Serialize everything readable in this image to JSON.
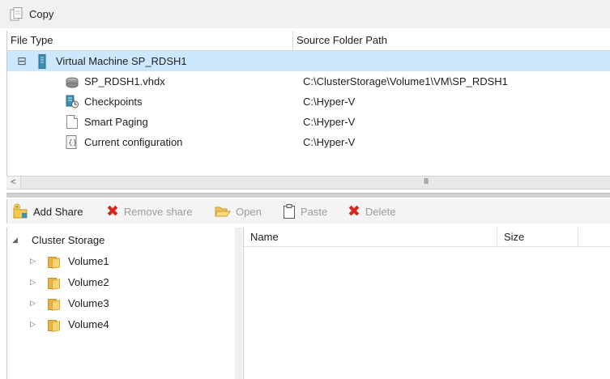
{
  "toolbar": {
    "copy_label": "Copy"
  },
  "grid": {
    "columns": [
      "File Type",
      "Source Folder Path"
    ],
    "vm_row": {
      "expander": "⊟",
      "label": "Virtual Machine SP_RDSH1"
    },
    "files": [
      {
        "name": "SP_RDSH1.vhdx",
        "path": "C:\\ClusterStorage\\Volume1\\VM\\SP_RDSH1",
        "icon": "disk-icon"
      },
      {
        "name": "Checkpoints",
        "path": "C:\\Hyper-V",
        "icon": "checkpoints-icon"
      },
      {
        "name": "Smart Paging",
        "path": "C:\\Hyper-V",
        "icon": "document-icon"
      },
      {
        "name": "Current configuration",
        "path": "C:\\Hyper-V",
        "icon": "configuration-icon"
      }
    ],
    "scroll_left": "<",
    "scroll_grip": "III"
  },
  "share_toolbar": {
    "add_share": "Add Share",
    "remove_share": "Remove share",
    "open": "Open",
    "paste": "Paste",
    "delete": "Delete"
  },
  "tree": {
    "root": {
      "expander": "◢",
      "label": "Cluster Storage"
    },
    "children": [
      {
        "expander": "▷",
        "label": "Volume1"
      },
      {
        "expander": "▷",
        "label": "Volume2"
      },
      {
        "expander": "▷",
        "label": "Volume3"
      },
      {
        "expander": "▷",
        "label": "Volume4"
      }
    ]
  },
  "list": {
    "columns": [
      "Name",
      "Size"
    ]
  }
}
